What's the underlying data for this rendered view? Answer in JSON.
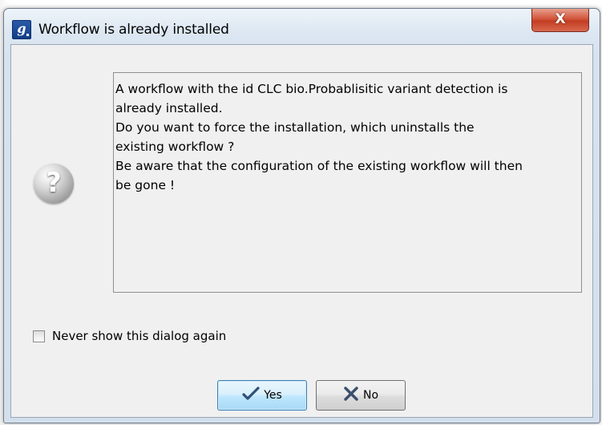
{
  "dialog": {
    "title": "Workflow is already installed",
    "app_icon_glyph": "g",
    "close_glyph": "X",
    "icon": "question-icon",
    "message_lines": [
      "A workflow with the id CLC bio.Probablisitic variant detection is",
      "already installed.",
      "Do you want to force the installation, which uninstalls the",
      "existing workflow ?",
      "Be aware that the configuration of the existing workflow will then",
      "be gone !"
    ],
    "never_show_label": "Never show this dialog again",
    "never_show_checked": false,
    "buttons": {
      "yes_label": "Yes",
      "yes_icon": "checkmark-icon",
      "no_label": "No",
      "no_icon": "x-icon"
    }
  },
  "colors": {
    "close_button": "#c9452a",
    "default_button_border": "#3c7fb1",
    "app_icon": "#1f4d98"
  }
}
